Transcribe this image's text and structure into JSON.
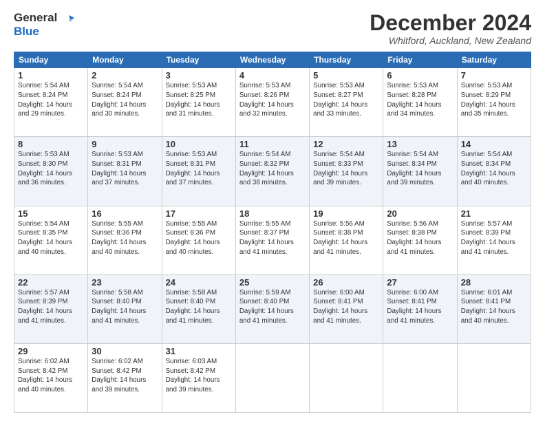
{
  "logo": {
    "line1": "General",
    "line2": "Blue"
  },
  "title": "December 2024",
  "subtitle": "Whitford, Auckland, New Zealand",
  "days_of_week": [
    "Sunday",
    "Monday",
    "Tuesday",
    "Wednesday",
    "Thursday",
    "Friday",
    "Saturday"
  ],
  "weeks": [
    [
      {
        "day": "1",
        "sunrise": "5:54 AM",
        "sunset": "8:24 PM",
        "daylight": "14 hours and 29 minutes."
      },
      {
        "day": "2",
        "sunrise": "5:54 AM",
        "sunset": "8:24 PM",
        "daylight": "14 hours and 30 minutes."
      },
      {
        "day": "3",
        "sunrise": "5:53 AM",
        "sunset": "8:25 PM",
        "daylight": "14 hours and 31 minutes."
      },
      {
        "day": "4",
        "sunrise": "5:53 AM",
        "sunset": "8:26 PM",
        "daylight": "14 hours and 32 minutes."
      },
      {
        "day": "5",
        "sunrise": "5:53 AM",
        "sunset": "8:27 PM",
        "daylight": "14 hours and 33 minutes."
      },
      {
        "day": "6",
        "sunrise": "5:53 AM",
        "sunset": "8:28 PM",
        "daylight": "14 hours and 34 minutes."
      },
      {
        "day": "7",
        "sunrise": "5:53 AM",
        "sunset": "8:29 PM",
        "daylight": "14 hours and 35 minutes."
      }
    ],
    [
      {
        "day": "8",
        "sunrise": "5:53 AM",
        "sunset": "8:30 PM",
        "daylight": "14 hours and 36 minutes."
      },
      {
        "day": "9",
        "sunrise": "5:53 AM",
        "sunset": "8:31 PM",
        "daylight": "14 hours and 37 minutes."
      },
      {
        "day": "10",
        "sunrise": "5:53 AM",
        "sunset": "8:31 PM",
        "daylight": "14 hours and 37 minutes."
      },
      {
        "day": "11",
        "sunrise": "5:54 AM",
        "sunset": "8:32 PM",
        "daylight": "14 hours and 38 minutes."
      },
      {
        "day": "12",
        "sunrise": "5:54 AM",
        "sunset": "8:33 PM",
        "daylight": "14 hours and 39 minutes."
      },
      {
        "day": "13",
        "sunrise": "5:54 AM",
        "sunset": "8:34 PM",
        "daylight": "14 hours and 39 minutes."
      },
      {
        "day": "14",
        "sunrise": "5:54 AM",
        "sunset": "8:34 PM",
        "daylight": "14 hours and 40 minutes."
      }
    ],
    [
      {
        "day": "15",
        "sunrise": "5:54 AM",
        "sunset": "8:35 PM",
        "daylight": "14 hours and 40 minutes."
      },
      {
        "day": "16",
        "sunrise": "5:55 AM",
        "sunset": "8:36 PM",
        "daylight": "14 hours and 40 minutes."
      },
      {
        "day": "17",
        "sunrise": "5:55 AM",
        "sunset": "8:36 PM",
        "daylight": "14 hours and 40 minutes."
      },
      {
        "day": "18",
        "sunrise": "5:55 AM",
        "sunset": "8:37 PM",
        "daylight": "14 hours and 41 minutes."
      },
      {
        "day": "19",
        "sunrise": "5:56 AM",
        "sunset": "8:38 PM",
        "daylight": "14 hours and 41 minutes."
      },
      {
        "day": "20",
        "sunrise": "5:56 AM",
        "sunset": "8:38 PM",
        "daylight": "14 hours and 41 minutes."
      },
      {
        "day": "21",
        "sunrise": "5:57 AM",
        "sunset": "8:39 PM",
        "daylight": "14 hours and 41 minutes."
      }
    ],
    [
      {
        "day": "22",
        "sunrise": "5:57 AM",
        "sunset": "8:39 PM",
        "daylight": "14 hours and 41 minutes."
      },
      {
        "day": "23",
        "sunrise": "5:58 AM",
        "sunset": "8:40 PM",
        "daylight": "14 hours and 41 minutes."
      },
      {
        "day": "24",
        "sunrise": "5:58 AM",
        "sunset": "8:40 PM",
        "daylight": "14 hours and 41 minutes."
      },
      {
        "day": "25",
        "sunrise": "5:59 AM",
        "sunset": "8:40 PM",
        "daylight": "14 hours and 41 minutes."
      },
      {
        "day": "26",
        "sunrise": "6:00 AM",
        "sunset": "8:41 PM",
        "daylight": "14 hours and 41 minutes."
      },
      {
        "day": "27",
        "sunrise": "6:00 AM",
        "sunset": "8:41 PM",
        "daylight": "14 hours and 41 minutes."
      },
      {
        "day": "28",
        "sunrise": "6:01 AM",
        "sunset": "8:41 PM",
        "daylight": "14 hours and 40 minutes."
      }
    ],
    [
      {
        "day": "29",
        "sunrise": "6:02 AM",
        "sunset": "8:42 PM",
        "daylight": "14 hours and 40 minutes."
      },
      {
        "day": "30",
        "sunrise": "6:02 AM",
        "sunset": "8:42 PM",
        "daylight": "14 hours and 39 minutes."
      },
      {
        "day": "31",
        "sunrise": "6:03 AM",
        "sunset": "8:42 PM",
        "daylight": "14 hours and 39 minutes."
      },
      null,
      null,
      null,
      null
    ]
  ]
}
